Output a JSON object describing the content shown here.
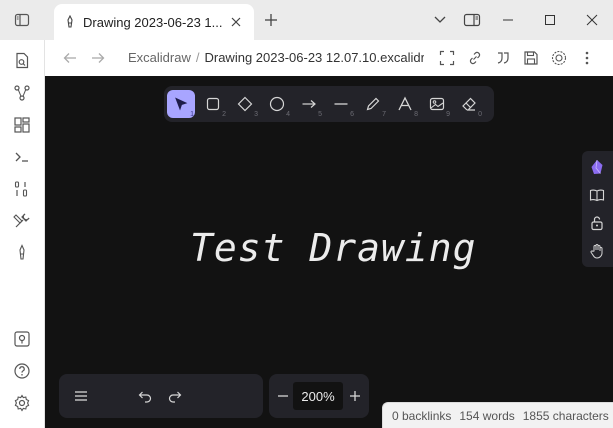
{
  "tab": {
    "title": "Drawing 2023-06-23 1..."
  },
  "breadcrumb": {
    "parent": "Excalidraw",
    "separator": "/",
    "current": "Drawing 2023-06-23 12.07.10.excalidr"
  },
  "toolbar": {
    "tools": [
      {
        "name": "selection",
        "key": "1",
        "active": true
      },
      {
        "name": "rectangle",
        "key": "2"
      },
      {
        "name": "diamond",
        "key": "3"
      },
      {
        "name": "ellipse",
        "key": "4"
      },
      {
        "name": "arrow",
        "key": "5"
      },
      {
        "name": "line",
        "key": "6"
      },
      {
        "name": "draw",
        "key": "7"
      },
      {
        "name": "text",
        "key": "8"
      },
      {
        "name": "image",
        "key": "9"
      },
      {
        "name": "eraser",
        "key": "0"
      }
    ]
  },
  "canvas": {
    "text": "Test Drawing"
  },
  "zoom": {
    "value": "200%"
  },
  "status": {
    "backlinks": "0 backlinks",
    "words": "154 words",
    "characters": "1855 characters"
  },
  "colors": {
    "accent": "#a8a5ff",
    "canvas_bg": "#121212",
    "island_bg": "#232329",
    "titlebar_bg": "#ebebeb"
  }
}
